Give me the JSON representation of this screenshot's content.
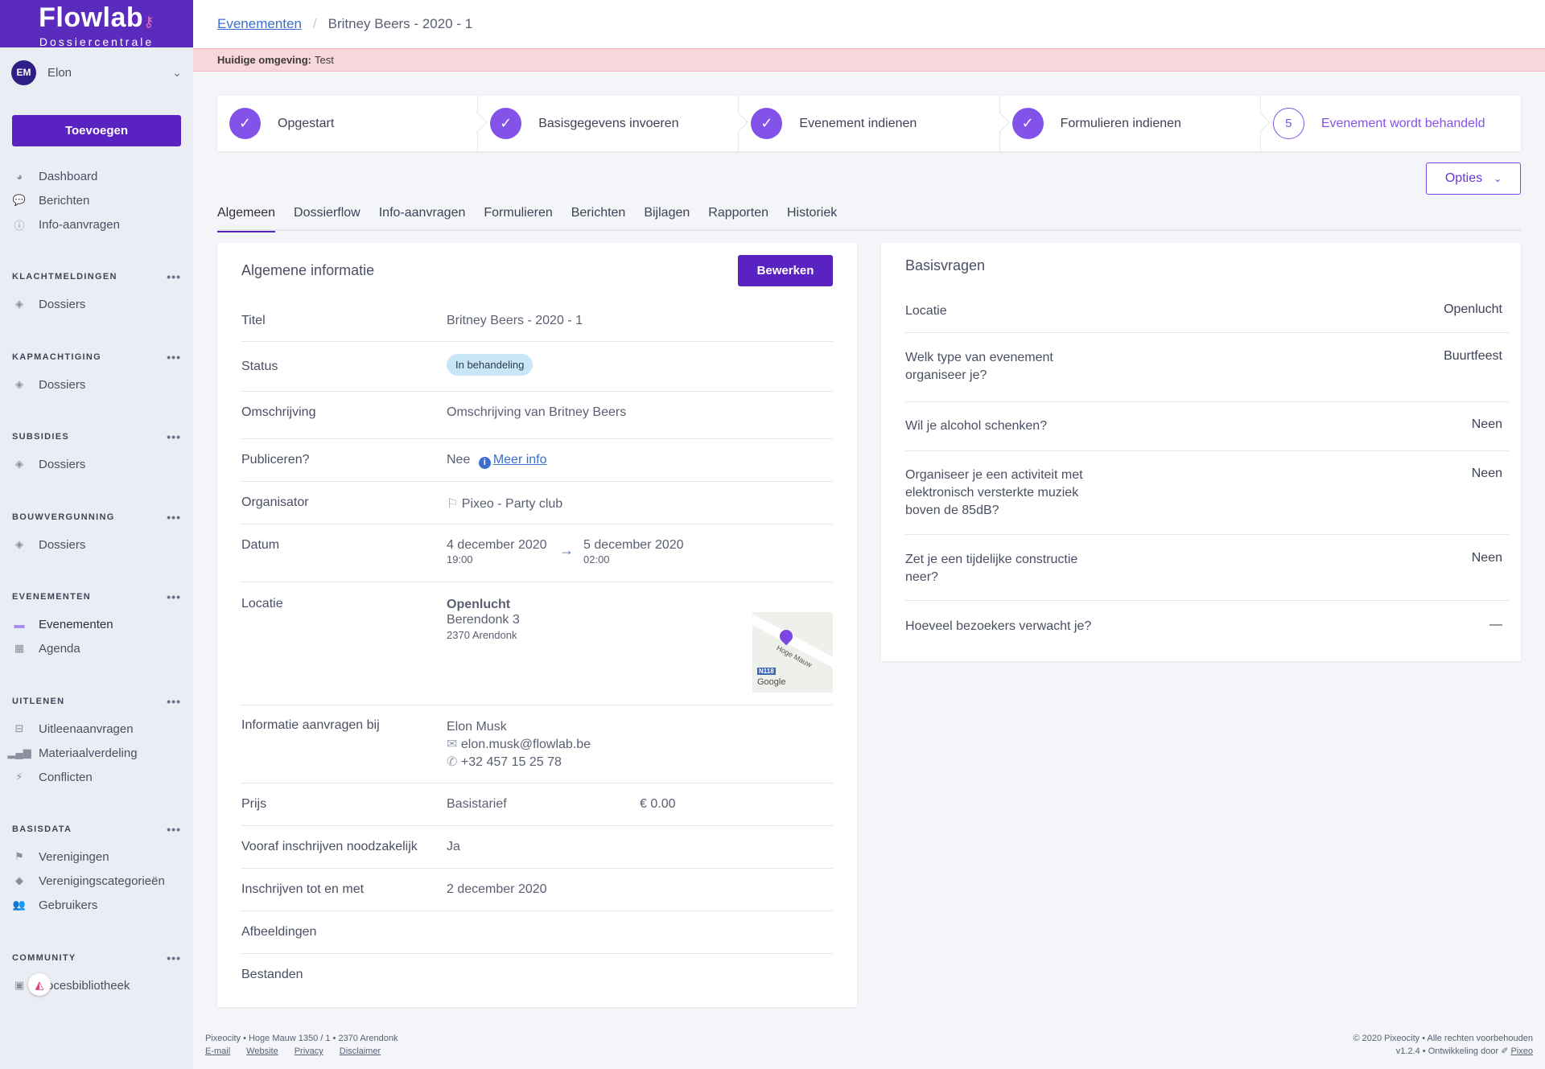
{
  "brand": {
    "name": "Flowlab",
    "subtitle": "Dossiercentrale"
  },
  "user": {
    "initials": "EM",
    "name": "Elon"
  },
  "sidebar": {
    "add_label": "Toevoegen",
    "top_items": [
      {
        "label": "Dashboard",
        "icon": "dashboard-icon"
      },
      {
        "label": "Berichten",
        "icon": "chat-icon"
      },
      {
        "label": "Info-aanvragen",
        "icon": "info-icon"
      }
    ],
    "sections": [
      {
        "title": "KLACHTMELDINGEN",
        "items": [
          {
            "label": "Dossiers",
            "icon": "layers-icon"
          }
        ]
      },
      {
        "title": "KAPMACHTIGING",
        "items": [
          {
            "label": "Dossiers",
            "icon": "layers-icon"
          }
        ]
      },
      {
        "title": "SUBSIDIES",
        "items": [
          {
            "label": "Dossiers",
            "icon": "layers-icon"
          }
        ]
      },
      {
        "title": "BOUWVERGUNNING",
        "items": [
          {
            "label": "Dossiers",
            "icon": "layers-icon"
          }
        ]
      },
      {
        "title": "EVENEMENTEN",
        "items": [
          {
            "label": "Evenementen",
            "icon": "ticket-icon"
          },
          {
            "label": "Agenda",
            "icon": "calendar-icon"
          }
        ]
      },
      {
        "title": "UITLENEN",
        "items": [
          {
            "label": "Uitleenaanvragen",
            "icon": "inbox-icon"
          },
          {
            "label": "Materiaalverdeling",
            "icon": "chart-icon"
          },
          {
            "label": "Conflicten",
            "icon": "bolt-icon"
          }
        ]
      },
      {
        "title": "BASISDATA",
        "items": [
          {
            "label": "Verenigingen",
            "icon": "flag-icon"
          },
          {
            "label": "Verenigingscategorieën",
            "icon": "tags-icon"
          },
          {
            "label": "Gebruikers",
            "icon": "users-icon"
          }
        ]
      },
      {
        "title": "COMMUNITY",
        "items": [
          {
            "label": "ocesbibliotheek",
            "icon": "book-icon"
          }
        ]
      }
    ],
    "more": "•••"
  },
  "breadcrumb": {
    "root": "Evenementen",
    "separator": "/",
    "current": "Britney Beers - 2020 - 1"
  },
  "environment": {
    "label": "Huidige omgeving:",
    "value": "Test"
  },
  "steps": [
    {
      "label": "Opgestart",
      "done": true
    },
    {
      "label": "Basisgegevens invoeren",
      "done": true
    },
    {
      "label": "Evenement indienen",
      "done": true
    },
    {
      "label": "Formulieren indienen",
      "done": true
    },
    {
      "label": "Evenement wordt behandeld",
      "done": false,
      "number": "5"
    }
  ],
  "options_label": "Opties",
  "tabs": [
    "Algemeen",
    "Dossierflow",
    "Info-aanvragen",
    "Formulieren",
    "Berichten",
    "Bijlagen",
    "Rapporten",
    "Historiek"
  ],
  "general": {
    "title": "Algemene informatie",
    "edit_label": "Bewerken",
    "titel_label": "Titel",
    "titel": "Britney Beers - 2020 - 1",
    "status_label": "Status",
    "status": "In behandeling",
    "omschrijving_label": "Omschrijving",
    "omschrijving": "Omschrijving van Britney Beers",
    "publiceren_label": "Publiceren?",
    "publiceren": "Nee",
    "meer_info": "Meer info",
    "organisator_label": "Organisator",
    "organisator": "Pixeo - Party club",
    "datum_label": "Datum",
    "start_date": "4 december 2020",
    "start_time": "19:00",
    "end_date": "5 december 2020",
    "end_time": "02:00",
    "locatie_label": "Locatie",
    "locatie_name": "Openlucht",
    "locatie_street": "Berendonk 3",
    "locatie_city": "2370 Arendonk",
    "map_road": "N118",
    "map_street": "Hoge Mauw",
    "map_brand": "Google",
    "contact_label": "Informatie aanvragen bij",
    "contact_name": "Elon Musk",
    "contact_email": "elon.musk@flowlab.be",
    "contact_phone": "+32 457 15 25 78",
    "prijs_label": "Prijs",
    "prijs_type": "Basistarief",
    "prijs_value": "€ 0.00",
    "vooraf_label": "Vooraf inschrijven noodzakelijk",
    "vooraf": "Ja",
    "tot_label": "Inschrijven tot en met",
    "tot": "2 december 2020",
    "afbeeldingen_label": "Afbeeldingen",
    "bestanden_label": "Bestanden"
  },
  "basic": {
    "title": "Basisvragen",
    "rows": [
      {
        "q": "Locatie",
        "a": "Openlucht"
      },
      {
        "q": "Welk type van evenement organiseer je?",
        "a": "Buurtfeest"
      },
      {
        "q": "Wil je alcohol schenken?",
        "a": "Neen"
      },
      {
        "q": "Organiseer je een activiteit met elektronisch versterkte muziek boven de 85dB?",
        "a": "Neen"
      },
      {
        "q": "Zet je een tijdelijke constructie neer?",
        "a": "Neen"
      },
      {
        "q": "Hoeveel bezoekers verwacht je?",
        "a": "—"
      }
    ]
  },
  "footer": {
    "address": "Pixeocity • Hoge Mauw 1350 / 1 • 2370 Arendonk",
    "links": [
      "E-mail",
      "Website",
      "Privacy",
      "Disclaimer"
    ],
    "copyright": "© 2020 Pixeocity • Alle rechten voorbehouden",
    "version": "v1.2.4 • Ontwikkeling door",
    "dev": "Pixeo"
  }
}
